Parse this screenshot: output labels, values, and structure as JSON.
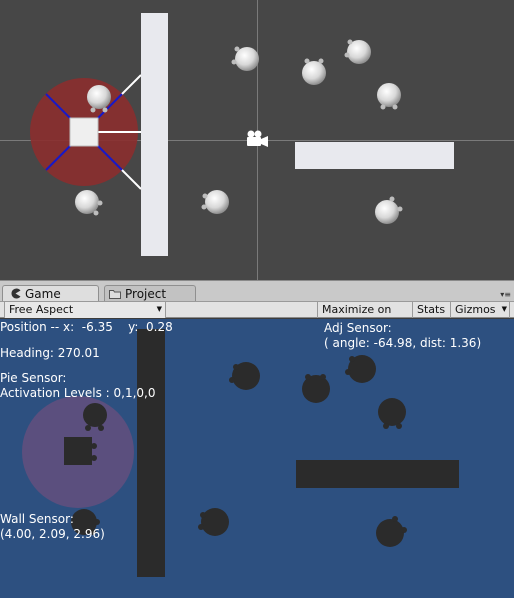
{
  "colors": {
    "scene_bg": "#474747",
    "game_bg": "#2d5080",
    "obstacle_dark": "#2b2b2b",
    "wall_light": "#e8e9ee",
    "pie_sensor_red": "#8b2e2e",
    "pie_line_blue": "#1818c8",
    "hud_text": "#ffffff"
  },
  "tabs": [
    {
      "label": "Game",
      "icon": "pacman-icon"
    },
    {
      "label": "Project",
      "icon": "folder-icon"
    }
  ],
  "toolbar": {
    "aspect_label": "Free Aspect",
    "maximize_label": "Maximize on Play",
    "stats_label": "Stats",
    "gizmos_label": "Gizmos"
  },
  "hud": {
    "position": "Position -- x:  -6.35    y:  0.28",
    "heading": "Heading: 270.01",
    "pie_title": "Pie Sensor:",
    "pie_levels": "Activation Levels : 0,1,0,0",
    "wall_title": "Wall Sensor:",
    "wall_values": "(4.00, 2.09, 2.96)",
    "adj_title": "Adj Sensor:",
    "adj_values": "( angle: -64.98, dist: 1.36)"
  }
}
